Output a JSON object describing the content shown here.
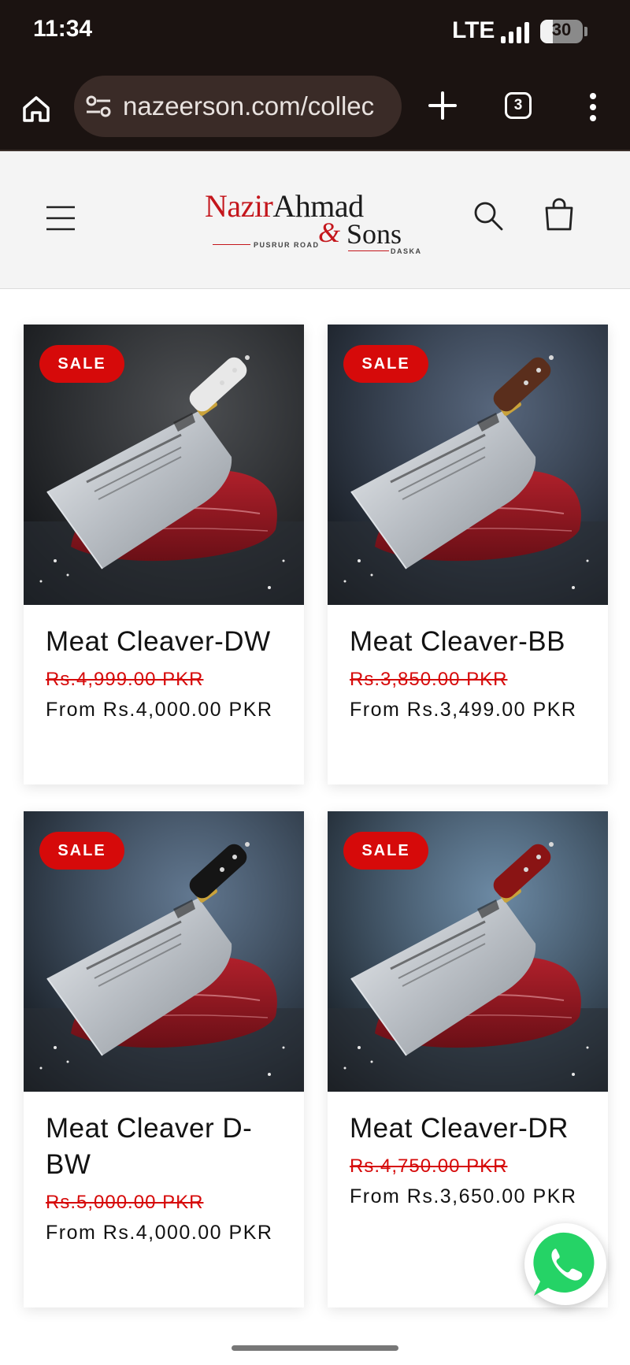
{
  "status_bar": {
    "time": "11:34",
    "network": "LTE",
    "battery_level": "30",
    "battery_fraction": 0.3,
    "signal_icon": "signal-icon",
    "battery_icon": "battery-icon"
  },
  "browser": {
    "url": "nazeerson.com/collec",
    "tab_count": "3",
    "icons": [
      "home-icon",
      "site-settings-icon",
      "plus-icon",
      "tabs-icon",
      "menu-dots-icon"
    ],
    "theme_color": "#1b1311"
  },
  "header": {
    "logo": {
      "word1": "Nazir",
      "word2": "Ahmad",
      "amp": "&",
      "word3": "Sons",
      "location_left": "PUSRUR ROAD",
      "location_right": "DASKA"
    },
    "icons": [
      "hamburger-icon",
      "search-icon",
      "cart-icon"
    ],
    "brand_red": "#c4161c"
  },
  "products": [
    {
      "title": "Meat Cleaver-DW",
      "badge": "SALE",
      "was_price": "Rs.4,999.00 PKR",
      "now_price": "From Rs.4,000.00 PKR",
      "handle_color": "#e8e8e8",
      "bg_color": "#111418"
    },
    {
      "title": "Meat Cleaver-BB",
      "badge": "SALE",
      "was_price": "Rs.3,850.00 PKR",
      "now_price": "From Rs.3,499.00 PKR",
      "handle_color": "#5a2e1c",
      "bg_color": "#1f3350"
    },
    {
      "title": "Meat Cleaver D-BW",
      "badge": "SALE",
      "was_price": "Rs.5,000.00 PKR",
      "now_price": "From Rs.4,000.00 PKR",
      "handle_color": "#151515",
      "bg_color": "#2d4a6a"
    },
    {
      "title": "Meat Cleaver-DR",
      "badge": "SALE",
      "was_price": "Rs.4,750.00 PKR",
      "now_price": "From Rs.3,650.00 PKR",
      "handle_color": "#8a1414",
      "bg_color": "#3b6285"
    }
  ],
  "sale_color": "#d60a0a",
  "floating": {
    "icon": "whatsapp-icon",
    "color": "#25d366"
  }
}
